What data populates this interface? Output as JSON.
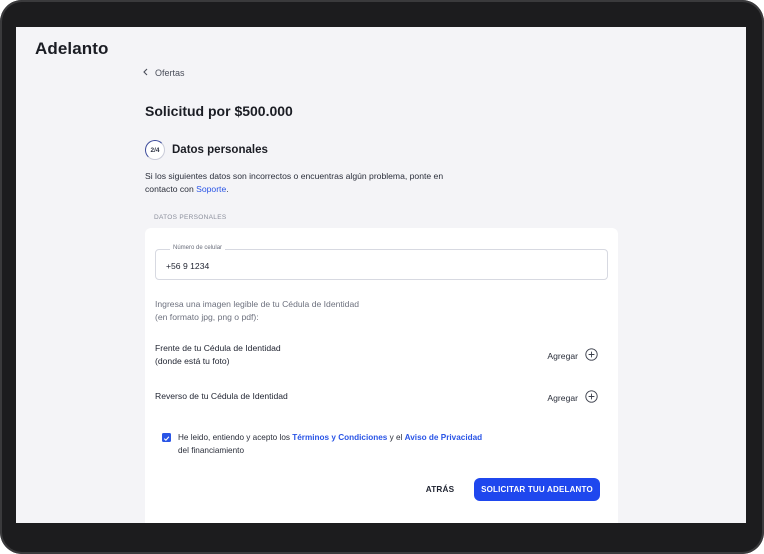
{
  "app": {
    "title": "Adelanto"
  },
  "nav": {
    "back_label": "Ofertas"
  },
  "request": {
    "title": "Solicitud por $500.000"
  },
  "step": {
    "indicator": "2/4",
    "title": "Datos personales"
  },
  "info": {
    "text": "Si los siguientes datos son incorrectos o encuentras algún problema, ponte en contacto con ",
    "link": "Soporte",
    "suffix": "."
  },
  "section": {
    "label": "DATOS PERSONALES"
  },
  "phone": {
    "label": "Número de celular",
    "value": "+56 9 1234"
  },
  "upload": {
    "hint_line1": "Ingresa una imagen legible de tu Cédula de Identidad",
    "hint_line2": "(en formato jpg, png o pdf):"
  },
  "documents": [
    {
      "label_line1": "Frente de tu Cédula de Identidad",
      "label_line2": "(donde está tu foto)",
      "action": "Agregar"
    },
    {
      "label_line1": "Reverso de tu Cédula de Identidad",
      "label_line2": "",
      "action": "Agregar"
    }
  ],
  "terms": {
    "checked": true,
    "prefix": "He leido, entiendo y acepto los ",
    "terms_link": "Términos y Condiciones",
    "middle": " y el ",
    "privacy_link": "Aviso de Privacidad",
    "suffix_line2": "del financiamiento"
  },
  "actions": {
    "back_label": "ATRÁS",
    "submit_label": "SOLICITAR TUU ADELANTO"
  },
  "colors": {
    "accent": "#1f47ee",
    "link": "#2a55e6",
    "bezel": "#1c1c1e",
    "screen_bg": "#f4f4f7"
  },
  "icons": {
    "back": "chevron-left-icon",
    "add": "plus-circle-icon",
    "check": "check-icon"
  }
}
